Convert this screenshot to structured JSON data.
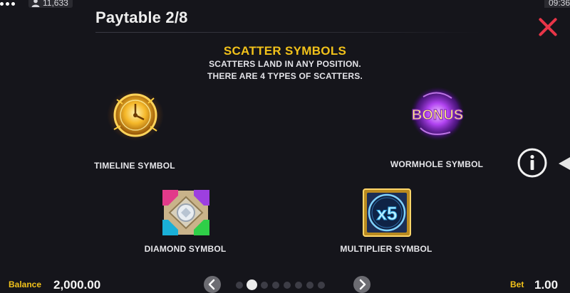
{
  "status": {
    "player_count": "11,633",
    "time": "09:36",
    "menu_icon": "more-dots-icon",
    "user_icon": "user-icon"
  },
  "header": {
    "title": "Paytable 2/8",
    "close_icon": "close-x-icon",
    "close_color": "#e83548"
  },
  "section": {
    "heading": "SCATTER SYMBOLS",
    "line1": "SCATTERS LAND IN ANY POSITION.",
    "line2": "THERE ARE 4 TYPES OF SCATTERS.",
    "heading_color": "#f2c21a"
  },
  "symbols": [
    {
      "label": "TIMELINE SYMBOL",
      "icon": "golden-clock-icon"
    },
    {
      "label": "WORMHOLE SYMBOL",
      "icon": "bonus-wormhole-icon",
      "text": "BONUS"
    },
    {
      "label": "DIAMOND SYMBOL",
      "icon": "diamond-gems-icon"
    },
    {
      "label": "MULTIPLIER SYMBOL",
      "icon": "multiplier-x5-icon",
      "text": "x5"
    }
  ],
  "controls": {
    "info_icon": "info-icon",
    "side_arrow_icon": "triangle-left-icon"
  },
  "footer": {
    "balance_label": "Balance",
    "balance_value": "2,000.00",
    "bet_label": "Bet",
    "bet_value": "1.00",
    "prev_icon": "chevron-left-icon",
    "next_icon": "chevron-right-icon",
    "page_dots": 8,
    "current_page": 2
  }
}
